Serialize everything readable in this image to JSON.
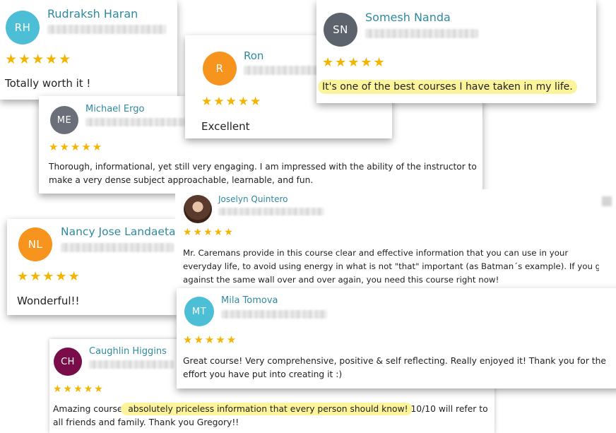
{
  "stars": "★★★★★",
  "colors": {
    "name": "#2f8aa0",
    "star": "#f4b400",
    "highlight": "#fcf49a"
  },
  "reviews": [
    {
      "initials": "RH",
      "avatar_color": "#4cbfd6",
      "name": "Rudraksh Haran",
      "text": "Totally worth it !"
    },
    {
      "initials": "ME",
      "avatar_color": "#6b6f7a",
      "name": "Michael Ergo",
      "text_lines": [
        "Thorough, informational, yet still very engaging. I am impressed with the ability of the instructor to",
        "make a very dense subject approachable, learnable, and fun."
      ]
    },
    {
      "initials": "R",
      "avatar_color": "#f7941d",
      "name": "Ron",
      "text": "Excellent"
    },
    {
      "initials": "SN",
      "avatar_color": "#5d636c",
      "name": "Somesh Nanda",
      "text": "It's one of the best courses I have taken in my life."
    },
    {
      "initials": "NL",
      "avatar_color": "#f7941d",
      "name": "Nancy Jose Landaeta",
      "text": "Wonderful!!"
    },
    {
      "photo": "profile-photo",
      "name": "Joselyn Quintero",
      "text_lines": [
        "Mr. Caremans provide in this course clear and effective information that you can use in your",
        "everyday life, to avoid using energy in what is not \"that\" important (as Batman´s example). If you go",
        "against the same wall over and over again, you need this course right now!"
      ]
    },
    {
      "initials": "MT",
      "avatar_color": "#4cbfd6",
      "name": "Mila Tomova",
      "text_lines": [
        "Great course! Very comprehensive, positive & self reflecting. Really enjoyed it! Thank you for the",
        "effort you have put into creating it :)"
      ]
    },
    {
      "initials": "CH",
      "avatar_color": "#7a0c4a",
      "name": "Caughlin Higgins",
      "text_line1_before": "Amazing course,",
      "text_line1_highlight": " absolutely priceless information that every person should know!",
      "text_line1_after": " 10/10 will refer to",
      "text_line2": "all friends and family. Thank you Gregory!!"
    }
  ]
}
